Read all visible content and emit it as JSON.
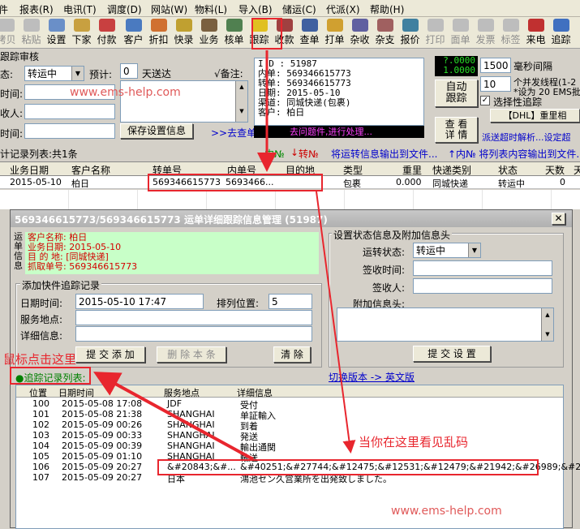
{
  "menu": [
    "报表(R)",
    "电讯(T)",
    "调度(D)",
    "网站(W)",
    "物料(L)",
    "导入(B)",
    "储运(C)",
    "代派(X)",
    "帮助(H)"
  ],
  "toolbar": [
    {
      "label": "拷贝",
      "icon": "copy-icon",
      "enabled": false,
      "color": "#bdbdbd"
    },
    {
      "label": "粘贴",
      "icon": "paste-icon",
      "enabled": false,
      "color": "#bdbdbd"
    },
    {
      "label": "设置",
      "icon": "settings-icon",
      "enabled": true,
      "color": "#6a8fc8"
    },
    {
      "label": "下家",
      "icon": "next-icon",
      "enabled": true,
      "color": "#c8a040"
    },
    {
      "label": "付款",
      "icon": "payment-icon",
      "enabled": true,
      "color": "#c84040"
    },
    {
      "label": "客户",
      "icon": "customer-icon",
      "enabled": true,
      "color": "#4a7ac0"
    },
    {
      "label": "折扣",
      "icon": "discount-icon",
      "enabled": true,
      "color": "#d07030"
    },
    {
      "label": "快录",
      "icon": "quick-entry-icon",
      "enabled": true,
      "color": "#c0a030"
    },
    {
      "label": "业务",
      "icon": "business-icon",
      "enabled": true,
      "color": "#7a6040"
    },
    {
      "label": "核单",
      "icon": "verify-icon",
      "enabled": true,
      "color": "#508050"
    },
    {
      "label": "跟踪",
      "icon": "tracking-icon",
      "enabled": true,
      "color": "#e0c020"
    },
    {
      "label": "收款",
      "icon": "receive-icon",
      "enabled": true,
      "color": "#a04040"
    },
    {
      "label": "查单",
      "icon": "search-order-icon",
      "enabled": true,
      "color": "#4060a0"
    },
    {
      "label": "打单",
      "icon": "print-order-icon",
      "enabled": true,
      "color": "#d0a030"
    },
    {
      "label": "杂收",
      "icon": "misc-income-icon",
      "enabled": true,
      "color": "#6060a0"
    },
    {
      "label": "杂支",
      "icon": "misc-expense-icon",
      "enabled": true,
      "color": "#a06060"
    },
    {
      "label": "报价",
      "icon": "quote-icon",
      "enabled": true,
      "color": "#4080a0"
    },
    {
      "label": "打印",
      "icon": "print-icon",
      "enabled": false,
      "color": "#bdbdbd"
    },
    {
      "label": "面单",
      "icon": "waybill-icon",
      "enabled": false,
      "color": "#bdbdbd"
    },
    {
      "label": "发票",
      "icon": "invoice-icon",
      "enabled": false,
      "color": "#bdbdbd"
    },
    {
      "label": "标签",
      "icon": "label-icon",
      "enabled": false,
      "color": "#bdbdbd"
    },
    {
      "label": "来电",
      "icon": "phone-icon",
      "enabled": true,
      "color": "#c03030"
    },
    {
      "label": "追踪",
      "icon": "trace-icon",
      "enabled": true,
      "color": "#4070c0"
    }
  ],
  "track": {
    "title": "跟踪审核",
    "status_label": "态:",
    "status_value": "转运中",
    "estimate_label": "预计:",
    "days_value": "0",
    "days_suffix": "天送达",
    "remark_label": "√备注:",
    "time_label": "时间:",
    "receiver_label": "收人:",
    "time2_label": "时间:",
    "save_btn": "保存设置信息",
    "goto_link": ">>去查单",
    "info_lines": [
      "I D :  51987",
      "内单:  569346615773",
      "转单:  569346615773",
      "日期:  2015-05-10",
      "渠道:  同城快递(包裹)",
      "客户:  柏日"
    ],
    "processing_text": "去问题件,进行处理...",
    "counter_top": "?.0000",
    "counter_bottom": "1.0000",
    "interval_value": "1500",
    "interval_label": "毫秒间隔",
    "threads_value": "10",
    "threads_label": "个并发线程(1-2",
    "threads_note": "*设为 20 EMS批",
    "auto_btn": "自动\n跟踪",
    "select_track_label": "选择性追踪",
    "dhl_btn": "【DHL】重里相",
    "view_btn": "查 看\n详 情",
    "timeout_text": "派送超时解析...设定超"
  },
  "list_bar": {
    "count_text": "计记录列表:共1条",
    "in_label": "内№",
    "out_label": "转№",
    "export_out": "将运转信息输出到文件...",
    "export_in": "↑内№ 将列表内容输出到文件..."
  },
  "grid": {
    "headers": [
      "业务日期",
      "客户名称",
      "转单号",
      "内单号",
      "目的地",
      "类型",
      "重里",
      "快递类别",
      "状态",
      "天数",
      "天"
    ],
    "row": {
      "date": "2015-05-10",
      "customer": "柏日",
      "tracking": "569346615773",
      "inner": "5693466...",
      "dest": "",
      "type": "包裹",
      "weight": "0.000",
      "category": "同城快递",
      "status": "转运中",
      "days": "0"
    }
  },
  "dialog": {
    "title": "569346615773/569346615773 运单详细跟踪信息管理 (51987)",
    "info_side": [
      "运",
      "单",
      "信",
      "息"
    ],
    "info_lines": [
      "客户名称: 柏日",
      "业务日期: 2015-05-10",
      "目 的 地: [同城快递]",
      "抓取单号: 569346615773"
    ],
    "add_group": "添加快件追踪记录",
    "date_label": "日期时间:",
    "date_value": "2015-05-10 17:47",
    "order_label": "排列位置:",
    "order_value": "5",
    "place_label": "服务地点:",
    "detail_label": "详细信息:",
    "submit_add": "提 交 添 加",
    "delete_btn": "删 除 本 条",
    "clear_btn": "清 除",
    "status_group": "设置状态信息及附加信息头",
    "ship_status_label": "运转状态:",
    "ship_status_value": "转运中",
    "sign_time_label": "签收时间:",
    "signer_label": "签收人:",
    "extra_label": "附加信息头:",
    "submit_settings": "提 交 设 置",
    "list_title": "●追踪记录列表:",
    "switch_link": "切换版本 -> 英文版",
    "list_headers": [
      "位置",
      "日期时间",
      "服务地点",
      "详细信息"
    ],
    "records": [
      {
        "pos": "100",
        "time": "2015-05-08 17:08",
        "place": "JDF",
        "detail": "受付"
      },
      {
        "pos": "101",
        "time": "2015-05-08 21:38",
        "place": "SHANGHAI",
        "detail": "单証輸入"
      },
      {
        "pos": "102",
        "time": "2015-05-09 00:26",
        "place": "SHANGHAI",
        "detail": "到着"
      },
      {
        "pos": "103",
        "time": "2015-05-09 00:33",
        "place": "SHANGHAI",
        "detail": "発送"
      },
      {
        "pos": "104",
        "time": "2015-05-09 00:39",
        "place": "SHANGHAI",
        "detail": "輸出通関"
      },
      {
        "pos": "105",
        "time": "2015-05-09 01:10",
        "place": "SHANGHAI",
        "detail": "輸送"
      },
      {
        "pos": "106",
        "time": "2015-05-09 20:27",
        "place": "&#20843;&#...",
        "detail": "&#40251;&#27744;&#12475;&#12531;&#12479;&#21942;&#26989;&#25..."
      },
      {
        "pos": "107",
        "time": "2015-05-09 20:27",
        "place": "日本",
        "detail": "鴻池セン久営業所を出発致しました。"
      }
    ]
  },
  "annotations": {
    "click_here": "鼠标点击这里",
    "garbled_here": "当你在这里看见乱码",
    "watermark": "www.ems-help.com"
  },
  "colors": {
    "annotation_red": "#e8262e",
    "title_bar": "#b8b8b8",
    "link_blue": "#0000cc",
    "processing_bg": "#000000",
    "processing_fg": "#ff40ff"
  }
}
